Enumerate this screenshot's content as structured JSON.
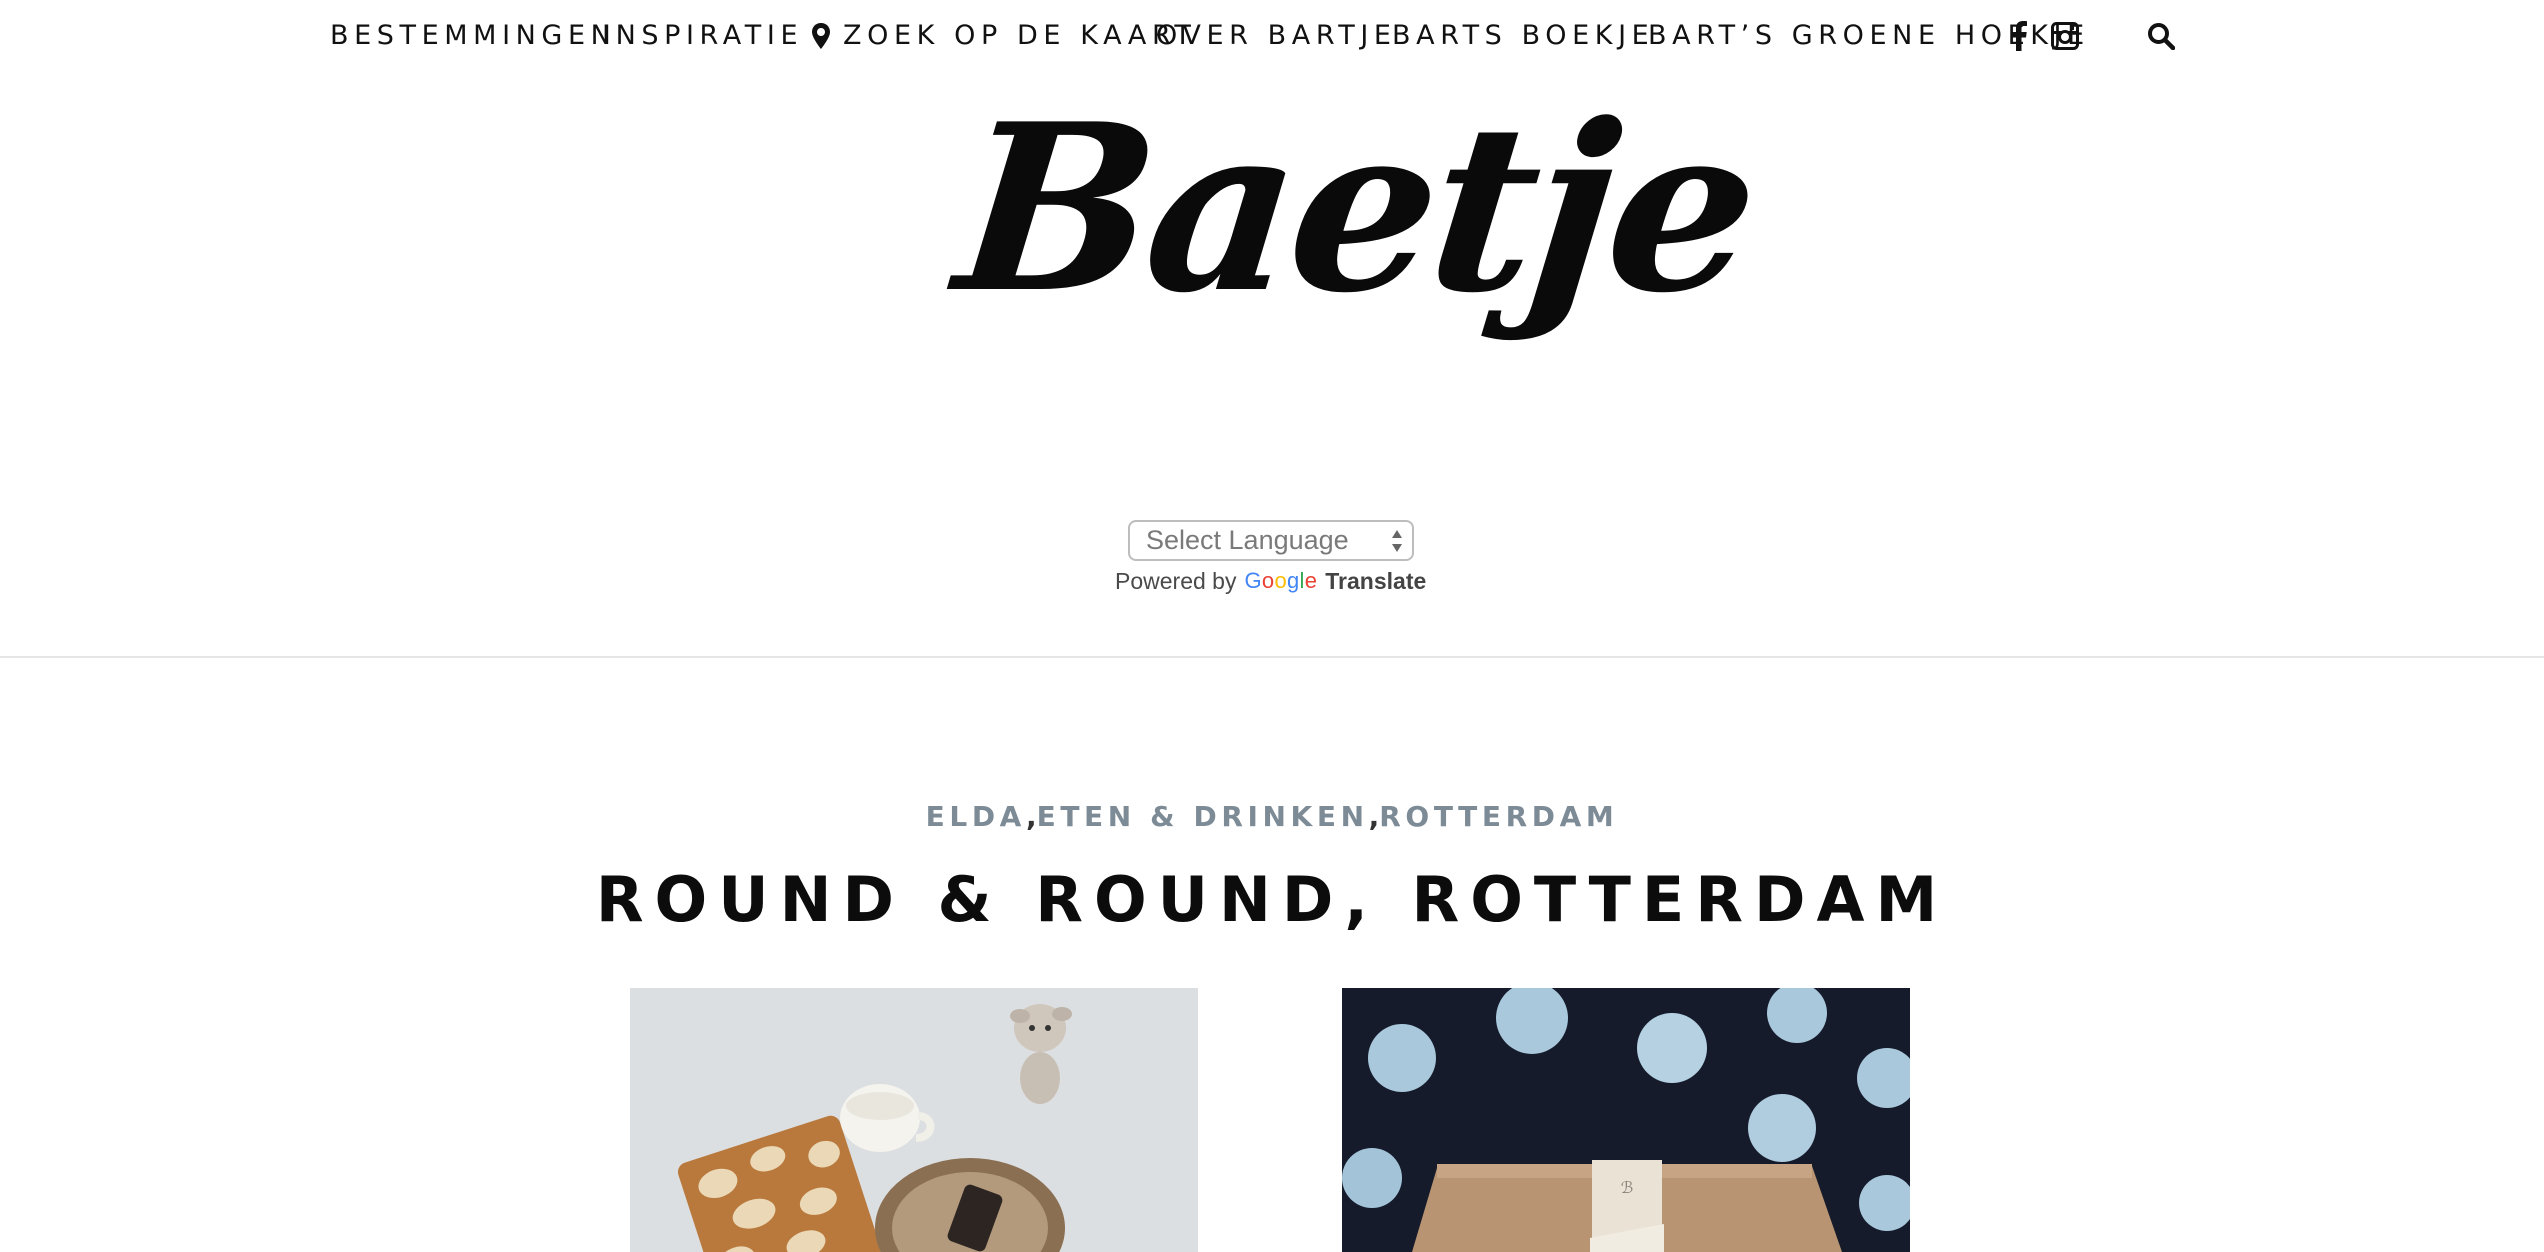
{
  "nav": {
    "items": [
      {
        "label": "BESTEMMINGEN"
      },
      {
        "label": "INSPIRATIE"
      },
      {
        "label": "ZOEK OP DE KAART"
      },
      {
        "label": "OVER BARTJE"
      },
      {
        "label": "BARTS BOEKJE"
      },
      {
        "label": "BART’S GROENE HOEKJE"
      }
    ],
    "icons": [
      "facebook-icon",
      "instagram-icon",
      "search-icon"
    ]
  },
  "logo": {
    "text": "Baetje"
  },
  "translate": {
    "select_value": "Select Language",
    "powered_by": "Powered by",
    "google": [
      "G",
      "o",
      "o",
      "g",
      "l",
      "e"
    ],
    "translate_label": "Translate"
  },
  "post": {
    "categories": [
      "ELDA",
      "ETEN & DRINKEN",
      "ROTTERDAM"
    ],
    "separator": ",",
    "title": "ROUND & ROUND, ROTTERDAM"
  },
  "colors": {
    "category": "#7d8b96",
    "google_blue": "#4285f4",
    "google_red": "#ea4335",
    "google_yellow": "#fbbc05",
    "google_green": "#34a853"
  }
}
